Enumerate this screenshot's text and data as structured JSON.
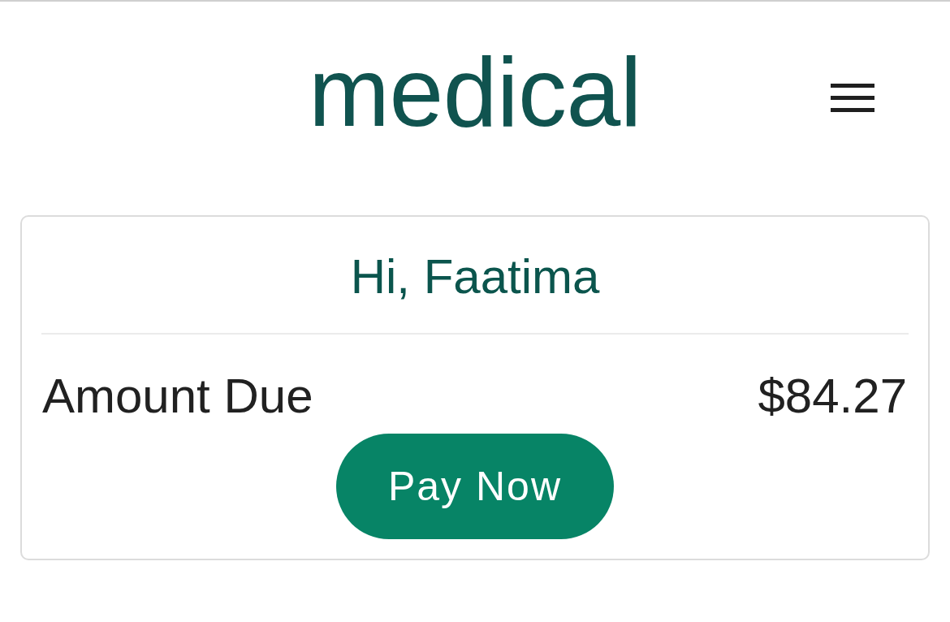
{
  "header": {
    "logo": "medical"
  },
  "card": {
    "greeting": "Hi, Faatima",
    "amount_label": "Amount Due",
    "amount_value": "$84.27",
    "button": "Pay Now"
  }
}
